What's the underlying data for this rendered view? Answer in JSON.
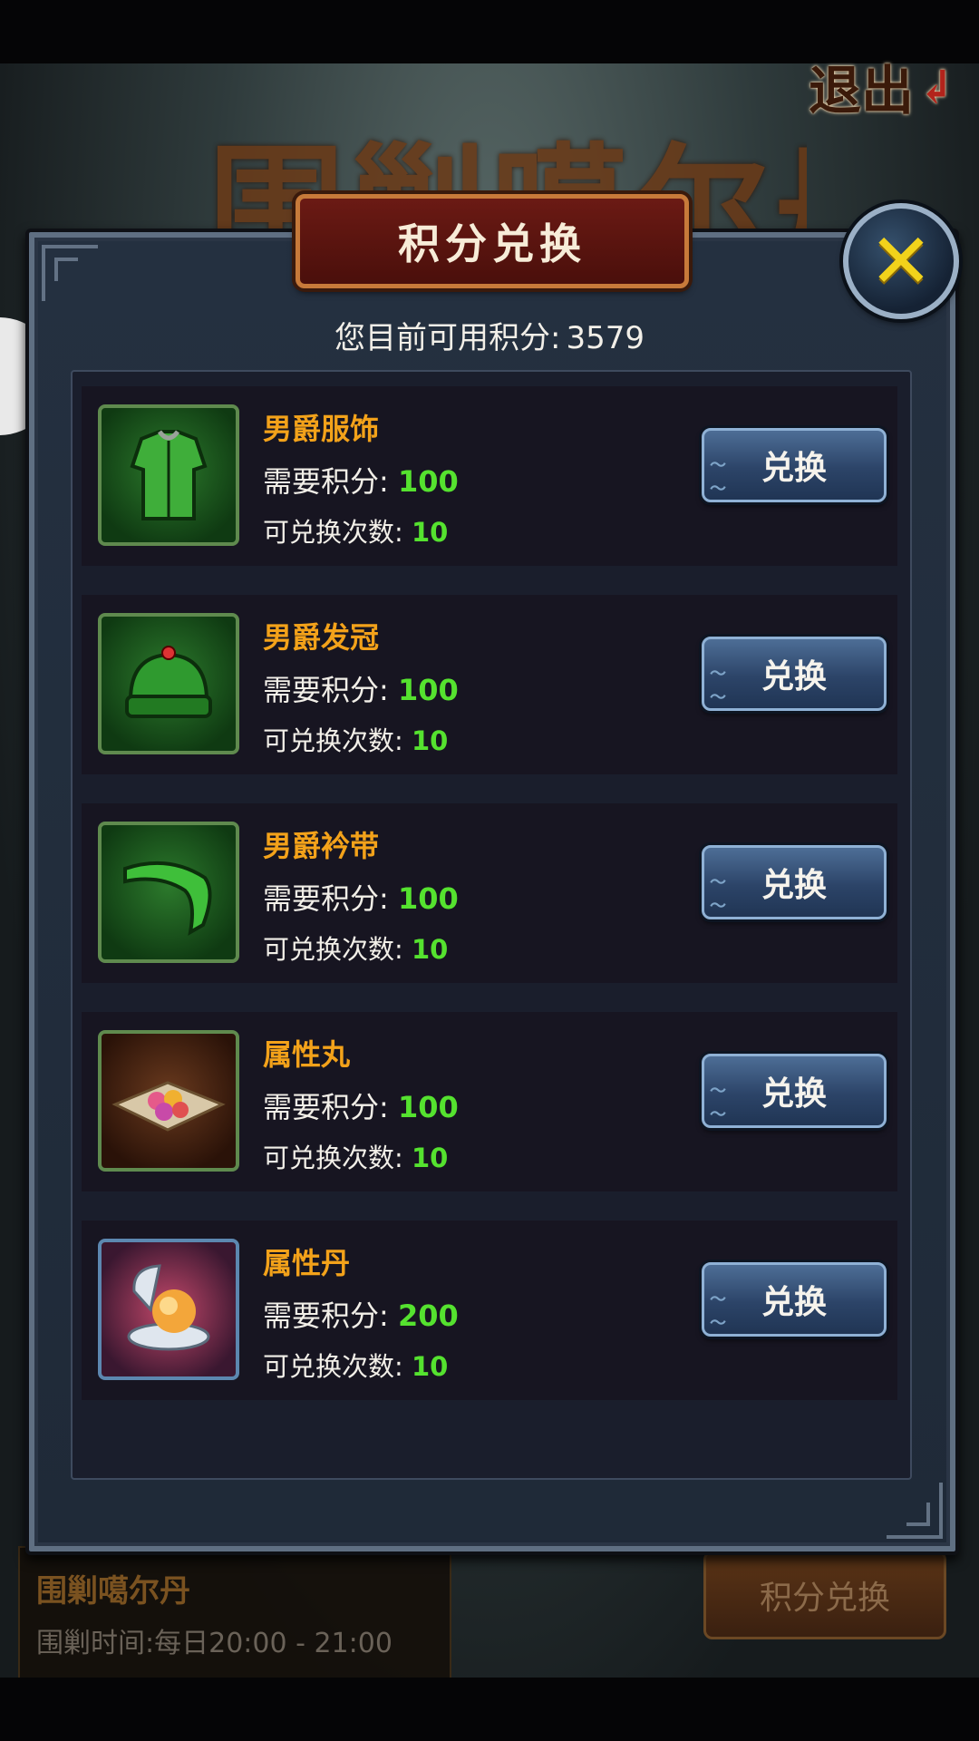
{
  "background": {
    "title_art": "围剿噶尔丹",
    "exit_label": "退出",
    "side_tab_glyph": "›"
  },
  "event_info": {
    "title": "围剿噶尔丹",
    "time_label": "围剿时间:",
    "time_value": "每日20:00 - 21:00"
  },
  "bottom_button_label": "积分兑换",
  "modal": {
    "title": "积分兑换",
    "close_icon": "x-icon",
    "points_label": "您目前可用积分:",
    "points_value": "3579",
    "items": [
      {
        "name": "男爵服饰",
        "req_label": "需要积分:",
        "req_value": "100",
        "count_label": "可兑换次数:",
        "count_value": "10",
        "button": "兑换",
        "icon": "robe-icon"
      },
      {
        "name": "男爵发冠",
        "req_label": "需要积分:",
        "req_value": "100",
        "count_label": "可兑换次数:",
        "count_value": "10",
        "button": "兑换",
        "icon": "hat-icon"
      },
      {
        "name": "男爵衿带",
        "req_label": "需要积分:",
        "req_value": "100",
        "count_label": "可兑换次数:",
        "count_value": "10",
        "button": "兑换",
        "icon": "sash-icon"
      },
      {
        "name": "属性丸",
        "req_label": "需要积分:",
        "req_value": "100",
        "count_label": "可兑换次数:",
        "count_value": "10",
        "button": "兑换",
        "icon": "pills-icon"
      },
      {
        "name": "属性丹",
        "req_label": "需要积分:",
        "req_value": "200",
        "count_label": "可兑换次数:",
        "count_value": "10",
        "button": "兑换",
        "icon": "elixir-orb-icon"
      }
    ]
  },
  "colors": {
    "item_name": "#f3a21a",
    "value_green": "#55e22f",
    "title_red": "#6b1a14"
  }
}
